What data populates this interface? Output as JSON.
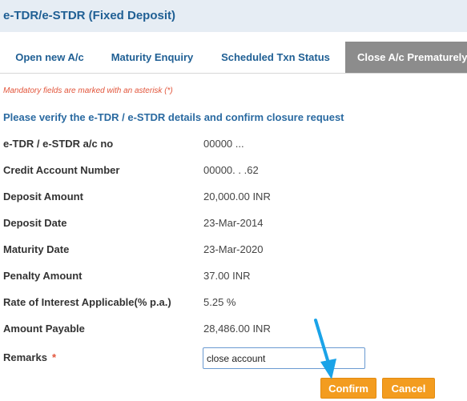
{
  "header": {
    "title": "e-TDR/e-STDR (Fixed Deposit)"
  },
  "tabs": [
    {
      "label": "Open new A/c"
    },
    {
      "label": "Maturity Enquiry"
    },
    {
      "label": "Scheduled Txn Status"
    },
    {
      "label": "Close A/c Prematurely"
    }
  ],
  "form": {
    "mandatory_note": "Mandatory fields are marked with an asterisk (*)",
    "section_title": "Please verify the e-TDR / e-STDR details and confirm closure request",
    "rows": [
      {
        "label": "e-TDR / e-STDR a/c no",
        "value": "00000          ..."
      },
      {
        "label": "Credit Account Number",
        "value": "00000.          . .62"
      },
      {
        "label": "Deposit Amount",
        "value": "20,000.00 INR"
      },
      {
        "label": "Deposit Date",
        "value": "23-Mar-2014"
      },
      {
        "label": "Maturity Date",
        "value": "23-Mar-2020"
      },
      {
        "label": "Penalty Amount",
        "value": "37.00 INR"
      },
      {
        "label": "Rate of Interest Applicable(% p.a.)",
        "value": "5.25 %"
      },
      {
        "label": "Amount Payable",
        "value": "28,486.00 INR"
      }
    ],
    "remarks_label": "Remarks",
    "remarks_required_mark": "*",
    "remarks_value": "close account"
  },
  "buttons": {
    "confirm": "Confirm",
    "cancel": "Cancel"
  },
  "colors": {
    "accent": "#f39c1f",
    "link": "#1f5f94",
    "active_tab": "#8c8c8c",
    "arrow": "#1aa3e8"
  }
}
